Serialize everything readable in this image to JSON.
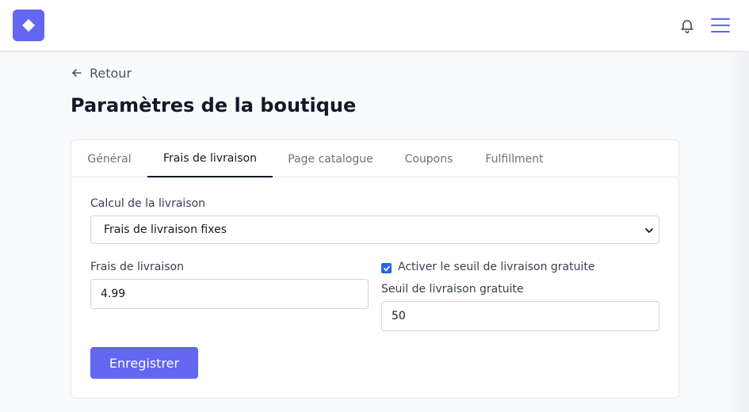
{
  "header": {
    "logo_icon": "diamond-icon",
    "notification_icon": "bell-icon",
    "menu_icon": "hamburger-icon",
    "accent_color": "#6366f1"
  },
  "back_link": {
    "label": "Retour",
    "icon": "arrow-left-icon"
  },
  "page_title": "Paramètres de la boutique",
  "tabs": [
    {
      "label": "Général",
      "active": false
    },
    {
      "label": "Frais de livraison",
      "active": true
    },
    {
      "label": "Page catalogue",
      "active": false
    },
    {
      "label": "Coupons",
      "active": false
    },
    {
      "label": "Fulfillment",
      "active": false
    }
  ],
  "form": {
    "shipping_calc": {
      "label": "Calcul de la livraison",
      "selected": "Frais de livraison fixes"
    },
    "shipping_fee": {
      "label": "Frais de livraison",
      "value": "4.99"
    },
    "free_shipping_toggle": {
      "label": "Activer le seuil de livraison gratuite",
      "checked": true
    },
    "free_shipping_threshold": {
      "label": "Seuil de livraison gratuite",
      "value": "50"
    },
    "save_label": "Enregistrer"
  }
}
